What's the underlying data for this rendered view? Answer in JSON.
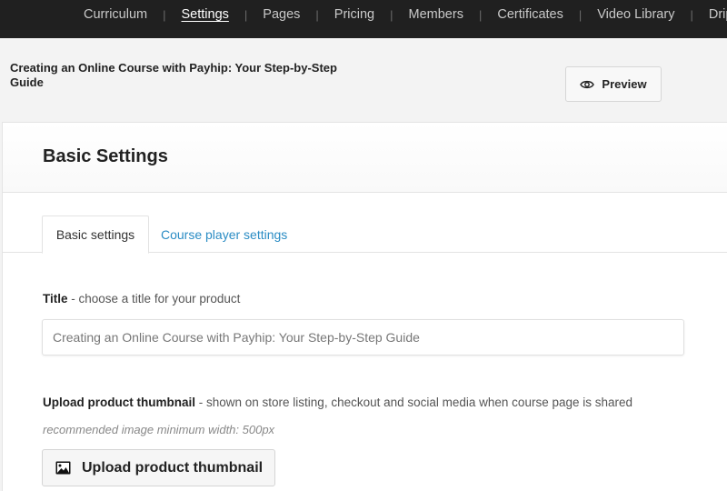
{
  "topnav": {
    "items": [
      {
        "label": "Curriculum",
        "active": false
      },
      {
        "label": "Settings",
        "active": true
      },
      {
        "label": "Pages",
        "active": false
      },
      {
        "label": "Pricing",
        "active": false
      },
      {
        "label": "Members",
        "active": false
      },
      {
        "label": "Certificates",
        "active": false
      },
      {
        "label": "Video Library",
        "active": false
      },
      {
        "label": "Drip",
        "active": false
      }
    ],
    "separator": "|"
  },
  "header": {
    "product_title": "Creating an Online Course with Payhip: Your Step-by-Step Guide",
    "preview_label": "Preview",
    "preview_icon": "eye-icon"
  },
  "card": {
    "title": "Basic Settings",
    "tabs": [
      {
        "label": "Basic settings",
        "active": true
      },
      {
        "label": "Course player settings",
        "active": false
      }
    ]
  },
  "form": {
    "title_field": {
      "label": "Title",
      "hint": " - choose a title for your product",
      "value": "Creating an Online Course with Payhip: Your Step-by-Step Guide"
    },
    "thumbnail": {
      "label": "Upload product thumbnail",
      "hint": " - shown on store listing, checkout and social media when course page is shared",
      "note": "recommended image minimum width: 500px",
      "button_label": "Upload product thumbnail",
      "button_icon": "image-icon"
    }
  },
  "colors": {
    "nav_bg": "#202020",
    "link": "#2a8cc4",
    "page_bg": "#f3f3f3"
  }
}
